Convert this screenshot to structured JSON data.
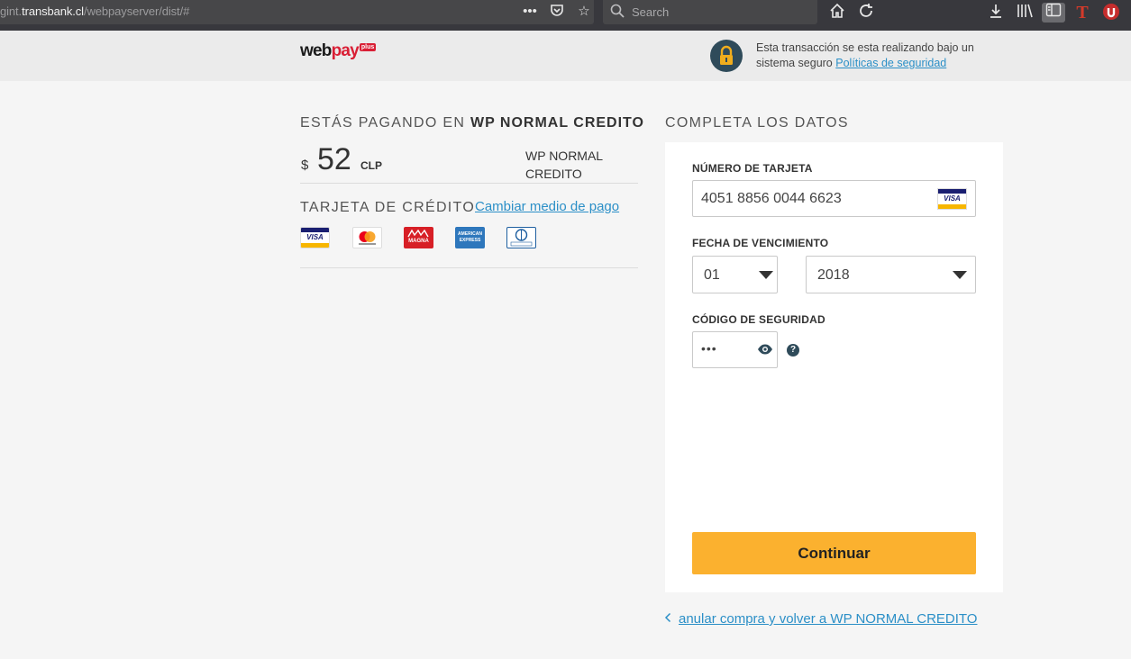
{
  "browser": {
    "url_prefix": "gint.",
    "url_host": "transbank.cl",
    "url_path": "/webpayserver/dist/#",
    "search_placeholder": "Search"
  },
  "header": {
    "logo_part1": "web",
    "logo_part2": "pay",
    "logo_plus": "plus",
    "secure_text": "Esta transacción se esta realizando bajo un sistema seguro",
    "security_link": "Políticas de seguridad"
  },
  "summary": {
    "paying_label": "ESTÁS PAGANDO EN",
    "merchant_name": "WP NORMAL CREDITO",
    "currency_symbol": "$",
    "amount": "52",
    "currency_code": "CLP",
    "merchant_line1": "WP NORMAL",
    "merchant_line2": "CREDITO",
    "method_label": "TARJETA DE CRÉDITO",
    "change_link": "Cambiar medio de pago",
    "brands": [
      {
        "name": "visa",
        "label": "VISA"
      },
      {
        "name": "mastercard",
        "label": "mastercard"
      },
      {
        "name": "magna",
        "label": "MAGNA"
      },
      {
        "name": "amex",
        "label": "AMERICAN EXPRESS"
      },
      {
        "name": "diners",
        "label": "Diners Club"
      }
    ]
  },
  "form": {
    "title": "COMPLETA LOS DATOS",
    "card_number_label": "NÚMERO DE TARJETA",
    "card_number_value": "4051 8856 0044 6623",
    "expiry_label": "FECHA DE VENCIMIENTO",
    "month_value": "01",
    "year_value": "2018",
    "cvv_label": "CÓDIGO DE SEGURIDAD",
    "cvv_value": "•••",
    "help_text": "?",
    "submit_label": "Continuar",
    "cancel_link": "anular compra y volver a WP NORMAL CREDITO"
  },
  "colors": {
    "accent": "#fbb12f",
    "link": "#2b8fc7",
    "brand_red": "#d91f35",
    "lock": "#2f4b5a"
  }
}
